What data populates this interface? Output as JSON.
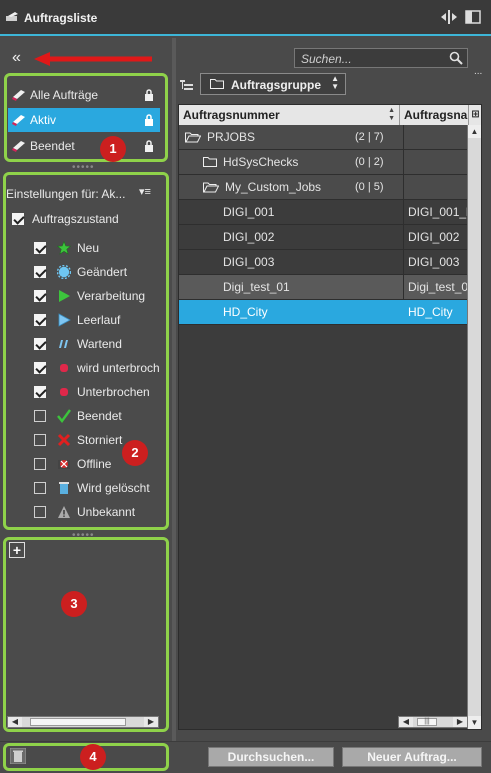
{
  "title_bar": {
    "title": "Auftragsliste"
  },
  "left_panel": {
    "collapse_label": "«",
    "filters": [
      {
        "label": "Alle Aufträge",
        "selected": false
      },
      {
        "label": "Aktiv",
        "selected": true
      },
      {
        "label": "Beendet",
        "selected": false
      }
    ],
    "settings_label": "Einstellungen für: Ak...",
    "settings_menu": "▾≡",
    "state_header": {
      "label": "Auftragszustand",
      "checked": true
    },
    "states": [
      {
        "label": "Neu",
        "checked": true,
        "icon": "star-icon",
        "color": "#3cc43c"
      },
      {
        "label": "Geändert",
        "checked": true,
        "icon": "gear-badge-icon",
        "color": "#6ec6f2"
      },
      {
        "label": "Verarbeitung",
        "checked": true,
        "icon": "play-icon",
        "color": "#3cc43c"
      },
      {
        "label": "Leerlauf",
        "checked": true,
        "icon": "play-outline-icon",
        "color": "#7fc6f2"
      },
      {
        "label": "Wartend",
        "checked": true,
        "icon": "pause-slanted-icon",
        "color": "#7fc6f2"
      },
      {
        "label": "wird unterbroch",
        "checked": true,
        "icon": "stop-dot-icon",
        "color": "#e0284a"
      },
      {
        "label": "Unterbrochen",
        "checked": true,
        "icon": "stop-dot-icon",
        "color": "#e0284a"
      },
      {
        "label": "Beendet",
        "checked": false,
        "icon": "checkmark-icon",
        "color": "#3cc43c"
      },
      {
        "label": "Storniert",
        "checked": false,
        "icon": "cross-icon",
        "color": "#e02020"
      },
      {
        "label": "Offline",
        "checked": false,
        "icon": "offline-icon",
        "color": "#d42a2a"
      },
      {
        "label": "Wird gelöscht",
        "checked": false,
        "icon": "trash-icon",
        "color": "#5ab0e0"
      },
      {
        "label": "Unbekannt",
        "checked": false,
        "icon": "warning-icon",
        "color": "#aaaaaa"
      }
    ],
    "add_label": "+"
  },
  "right_panel": {
    "search_placeholder": "Suchen...",
    "group_selector": "Auftragsgruppe",
    "columns": [
      "Auftragsnummer",
      "Auftragsna"
    ],
    "rows": [
      {
        "name": "PRJOBS",
        "count": "(2 | 7)",
        "col2": "",
        "kind": "group-root"
      },
      {
        "name": "HdSysChecks",
        "count": "(0 | 2)",
        "col2": "",
        "kind": "group"
      },
      {
        "name": "My_Custom_Jobs",
        "count": "(0 | 5)",
        "col2": "",
        "kind": "group-open"
      },
      {
        "name": "DIGI_001",
        "count": "",
        "col2": "DIGI_001_l",
        "kind": "job"
      },
      {
        "name": "DIGI_002",
        "count": "",
        "col2": "DIGI_002",
        "kind": "job"
      },
      {
        "name": "DIGI_003",
        "count": "",
        "col2": "DIGI_003",
        "kind": "job"
      },
      {
        "name": "Digi_test_01",
        "count": "",
        "col2": "Digi_test_0",
        "kind": "job"
      },
      {
        "name": "HD_City",
        "count": "",
        "col2": "HD_City",
        "kind": "job-selected"
      }
    ]
  },
  "bottom_bar": {
    "browse_button": "Durchsuchen...",
    "new_job_button": "Neuer Auftrag..."
  },
  "annotations": [
    "1",
    "2",
    "3",
    "4"
  ],
  "colors": {
    "accent": "#2aa8df",
    "highlight": "#8fd24a",
    "marker": "#cc1f1f"
  }
}
